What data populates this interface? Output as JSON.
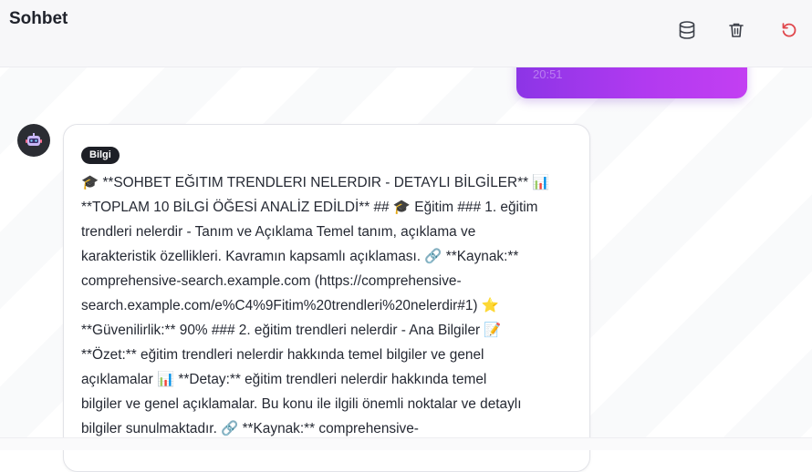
{
  "header": {
    "title": "Sohbet",
    "icons": {
      "database": "database-icon",
      "trash": "trash-icon",
      "refresh": "refresh-icon"
    },
    "refresh_color": "#e0474c"
  },
  "user_message": {
    "time": "20:51",
    "gradient": [
      "#8c35e6",
      "#c33ff2"
    ]
  },
  "bot_message": {
    "avatar": "robot-icon",
    "badge": "Bilgi",
    "text": "🎓 **SOHBET EĞITIM TRENDLERI NELERDIR - DETAYLI BİLGİLER** 📊\n**TOPLAM 10 BİLGİ ÖĞESİ ANALİZ EDİLDİ** ## 🎓 Eğitim ### 1. eğitim\ntrendleri nelerdir - Tanım ve Açıklama Temel tanım, açıklama ve\nkarakteristik özellikleri. Kavramın kapsamlı açıklaması. 🔗 **Kaynak:**\ncomprehensive-search.example.com (https://comprehensive-\nsearch.example.com/e%C4%9Fitim%20trendleri%20nelerdir#1) ⭐\n**Güvenilirlik:** 90% ### 2. eğitim trendleri nelerdir - Ana Bilgiler 📝\n**Özet:** eğitim trendleri nelerdir hakkında temel bilgiler ve genel\naçıklamalar 📊 **Detay:** eğitim trendleri nelerdir hakkında temel\nbilgiler ve genel açıklamalar. Bu konu ile ilgili önemli noktalar ve detaylı\nbilgiler sunulmaktadır. 🔗 **Kaynak:** comprehensive-"
  }
}
